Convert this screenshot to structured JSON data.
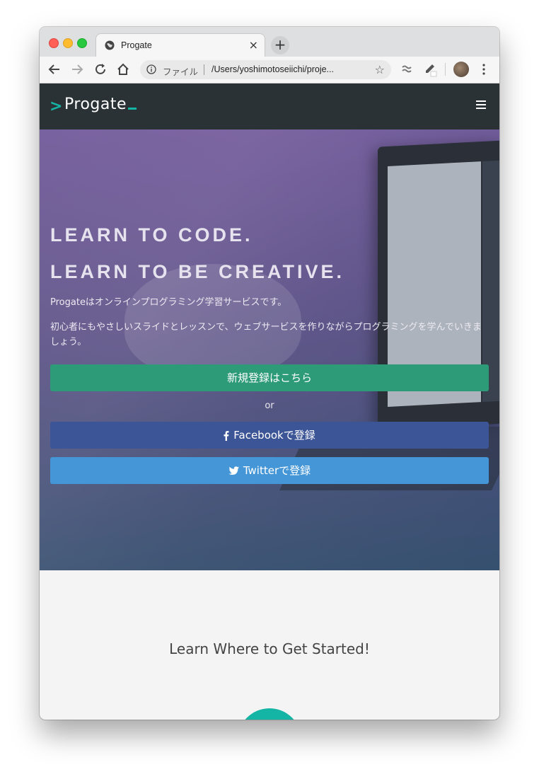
{
  "browser": {
    "tab_title": "Progate",
    "tab_close": "×",
    "new_tab": "+",
    "scheme_label": "ファイル",
    "url": "/Users/yoshimotoseiichi/proje..."
  },
  "navbar": {
    "logo_arrow": ">",
    "logo_text": "Progate"
  },
  "hero": {
    "headline_1": "LEARN TO CODE.",
    "headline_2": "LEARN TO BE CREATIVE.",
    "description_1": "Progateはオンラインプログラミング学習サービスです。",
    "description_2": "初心者にもやさしいスライドとレッスンで、ウェブサービスを作りながらプログラミングを学んでいきましょう。",
    "signup_label": "新規登録はこちら",
    "or_label": "or",
    "facebook_label": "Facebookで登録",
    "twitter_label": "Twitterで登録"
  },
  "section": {
    "title": "Learn Where to Get Started!"
  },
  "colors": {
    "navbar": "#2a3236",
    "accent": "#15b5a6",
    "signup": "#2d9a78",
    "facebook": "#3b5597",
    "twitter": "#4596d6"
  }
}
